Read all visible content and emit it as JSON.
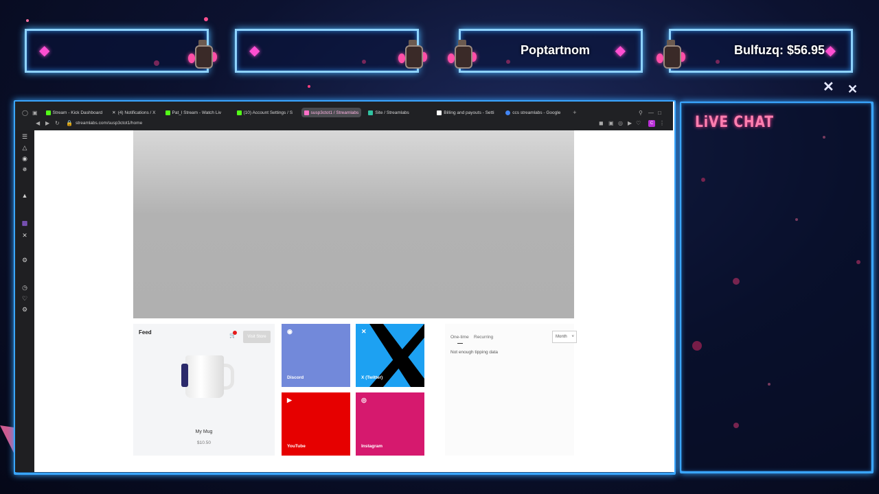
{
  "overlay": {
    "alerts": [
      {
        "text": ""
      },
      {
        "text": ""
      },
      {
        "text": "Poptartnom"
      },
      {
        "text": "Bulfuzq: $56.95"
      }
    ],
    "chat_title": "LiVE CHAT",
    "colors": {
      "frame": "#3aa6ff",
      "accent": "#ff4fd1"
    }
  },
  "browser": {
    "tabs": [
      {
        "label": "Stream - Kick Dashboard",
        "color": "#53fc18"
      },
      {
        "label": "(4) Notifications / X",
        "color": "#ffffff"
      },
      {
        "label": "Pat_l Stream - Watch Liv",
        "color": "#53fc18"
      },
      {
        "label": "(10) Account Settings / S",
        "color": "#53fc18"
      },
      {
        "label": "susp3ctot1 / Streamlabs",
        "color": "#80f5d2",
        "active": true
      },
      {
        "label": "Site / Streamlabs",
        "color": "#31c3a2"
      },
      {
        "label": "Billing and payouts - Setti",
        "color": "#ffffff"
      },
      {
        "label": "ccs streamlabs - Google",
        "color": "#4285f4"
      }
    ],
    "url": "streamlabs.com/susp3ctot1/home"
  },
  "page": {
    "feed": {
      "title": "Feed",
      "visit_store": "Visit Store",
      "cart_count": "0",
      "product_name": "My Mug",
      "product_price": "$10.50"
    },
    "socials": [
      {
        "label": "Discord",
        "color": "#7289da",
        "icon": "discord-icon"
      },
      {
        "label": "X (Twitter)",
        "color": "#1da1f2",
        "icon": "x-icon"
      },
      {
        "label": "YouTube",
        "color": "#e60000",
        "icon": "youtube-icon"
      },
      {
        "label": "Instagram",
        "color": "#d6196e",
        "icon": "instagram-icon"
      }
    ],
    "tips": {
      "one_time": "One-time",
      "recurring": "Recurring",
      "period": "Month",
      "empty": "Not enough tipping data"
    }
  }
}
